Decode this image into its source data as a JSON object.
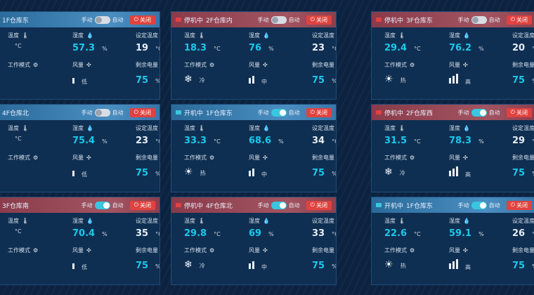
{
  "labels": {
    "manual": "手动",
    "auto": "自动",
    "temperature": "温度",
    "humidity": "湿度",
    "set_temp": "设定温度",
    "mode": "工作模式",
    "wind": "风量",
    "battery": "剩余电量",
    "power_off": "关闭",
    "deg": "°C",
    "pct": "%"
  },
  "colors": {
    "accent": "#1cc8ea",
    "danger": "#e0423f",
    "header_blue": "#4a8ec1",
    "header_red": "#a25461"
  },
  "cards": [
    {
      "status": "",
      "status_color": "",
      "location": "1F仓库东",
      "theme": "blue",
      "auto_on": false,
      "temp": "",
      "humidity": "57.3",
      "set_temp": "19",
      "mode_icon": "",
      "mode_label": "",
      "wind_icon": "bar",
      "wind_label": "低",
      "battery": "75"
    },
    {
      "status": "停机中",
      "status_color": "#e0423f",
      "location": "2F仓库内",
      "theme": "red",
      "auto_on": false,
      "temp": "18.3",
      "humidity": "76",
      "set_temp": "23",
      "mode_icon": "snow-icon",
      "mode_label": "冷",
      "wind_icon": "bars-2",
      "wind_label": "中",
      "battery": "75"
    },
    {
      "status": "停机中",
      "status_color": "#e0423f",
      "location": "3F仓库东",
      "theme": "red",
      "auto_on": false,
      "temp": "29.4",
      "humidity": "76.2",
      "set_temp": "20",
      "mode_icon": "sun-icon",
      "mode_label": "热",
      "wind_icon": "bars-3",
      "wind_label": "高",
      "battery": "75"
    },
    {
      "status": "",
      "status_color": "",
      "location": "4F仓库北",
      "theme": "blue",
      "auto_on": false,
      "temp": "",
      "humidity": "75.4",
      "set_temp": "23",
      "mode_icon": "",
      "mode_label": "",
      "wind_icon": "bar",
      "wind_label": "低",
      "battery": "75"
    },
    {
      "status": "开机中",
      "status_color": "#39c6de",
      "location": "1F仓库东",
      "theme": "blue",
      "auto_on": true,
      "temp": "33.3",
      "humidity": "68.6",
      "set_temp": "34",
      "mode_icon": "sun-icon",
      "mode_label": "热",
      "wind_icon": "bars-2",
      "wind_label": "中",
      "battery": "75"
    },
    {
      "status": "停机中",
      "status_color": "#e0423f",
      "location": "2F仓库西",
      "theme": "red",
      "auto_on": true,
      "temp": "31.5",
      "humidity": "78.3",
      "set_temp": "29",
      "mode_icon": "snow-icon",
      "mode_label": "冷",
      "wind_icon": "bars-3",
      "wind_label": "高",
      "battery": "75"
    },
    {
      "status": "",
      "status_color": "",
      "location": "3F仓库南",
      "theme": "red",
      "auto_on": true,
      "temp": "",
      "humidity": "70.4",
      "set_temp": "35",
      "mode_icon": "",
      "mode_label": "",
      "wind_icon": "bar",
      "wind_label": "低",
      "battery": "75"
    },
    {
      "status": "停机中",
      "status_color": "#e0423f",
      "location": "4F仓库北",
      "theme": "red",
      "auto_on": true,
      "temp": "29.8",
      "humidity": "69",
      "set_temp": "33",
      "mode_icon": "snow-icon",
      "mode_label": "冷",
      "wind_icon": "bars-2",
      "wind_label": "中",
      "battery": "75"
    },
    {
      "status": "开机中",
      "status_color": "#39c6de",
      "location": "1F仓库东",
      "theme": "blue",
      "auto_on": true,
      "temp": "22.6",
      "humidity": "59.1",
      "set_temp": "26",
      "mode_icon": "sun-icon",
      "mode_label": "热",
      "wind_icon": "bars-3",
      "wind_label": "高",
      "battery": "75"
    }
  ]
}
